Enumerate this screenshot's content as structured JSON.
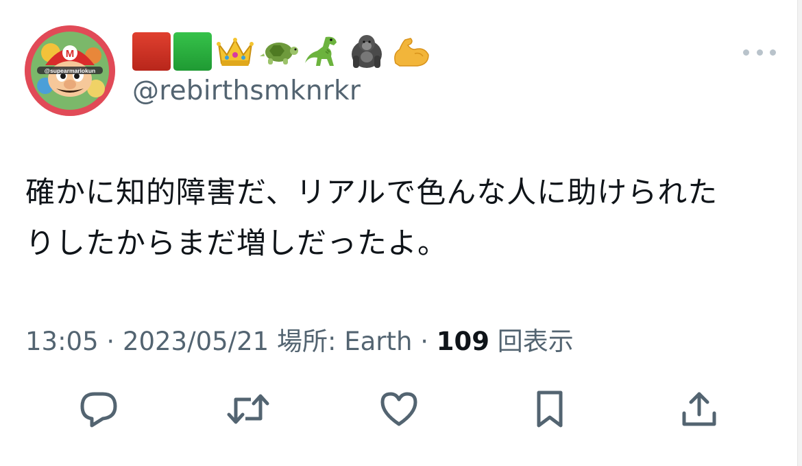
{
  "user": {
    "avatar_label": "@supearmariokun",
    "display_name_icons": [
      "red-square",
      "green-square",
      "crown",
      "turtle",
      "dinosaur",
      "gorilla",
      "flexed-biceps"
    ],
    "handle": "@rebirthsmknrkr"
  },
  "tweet": {
    "text_line_1": "確かに知的障害だ、リアルで色んな人に助けられた",
    "text_line_2": "りしたからまだ増しだったよ。"
  },
  "meta": {
    "time": "13:05",
    "separator_1": " · ",
    "date": "2023/05/21",
    "location_label": " 場所: ",
    "location": "Earth",
    "separator_2": " · ",
    "views_count": "109",
    "views_label": " 回表示"
  },
  "actions": [
    "reply-icon",
    "retweet-icon",
    "like-icon",
    "bookmark-icon",
    "share-icon"
  ],
  "colors": {
    "text_primary": "#0f1419",
    "text_secondary": "#536471",
    "icon": "#536471"
  }
}
